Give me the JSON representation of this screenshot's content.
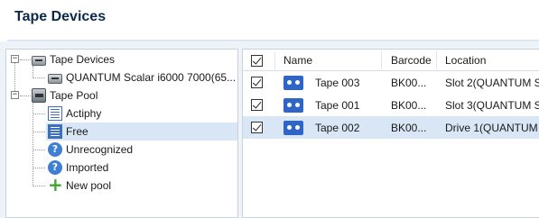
{
  "page": {
    "title": "Tape Devices"
  },
  "tree": {
    "items": [
      {
        "label": "Tape Devices",
        "icon": "tape-devices-icon"
      },
      {
        "label": "QUANTUM Scalar i6000 7000(65...",
        "icon": "tape-library-icon"
      },
      {
        "label": "Tape Pool",
        "icon": "tape-pool-icon"
      },
      {
        "label": "Actiphy",
        "icon": "pool-list-icon"
      },
      {
        "label": "Free",
        "icon": "pool-list-icon"
      },
      {
        "label": "Unrecognized",
        "icon": "question-icon"
      },
      {
        "label": "Imported",
        "icon": "question-icon"
      },
      {
        "label": "New pool",
        "icon": "plus-icon"
      }
    ],
    "expanders": [
      "−",
      "−"
    ],
    "selected_index": 4
  },
  "grid": {
    "columns": [
      "",
      "Name",
      "Barcode",
      "Location"
    ],
    "rows": [
      {
        "checked": true,
        "name": "Tape 003",
        "barcode": "BK00...",
        "location": "Slot 2(QUANTUM S"
      },
      {
        "checked": true,
        "name": "Tape 001",
        "barcode": "BK00...",
        "location": "Slot 3(QUANTUM S"
      },
      {
        "checked": true,
        "name": "Tape 002",
        "barcode": "BK00...",
        "location": "Drive 1(QUANTUM"
      }
    ],
    "header_checked": true,
    "selected_row": 2
  },
  "colors": {
    "title": "#0b2a4a",
    "selection": "#d8e6f6",
    "tape_icon": "#2f66c6",
    "plus": "#3fa535"
  }
}
